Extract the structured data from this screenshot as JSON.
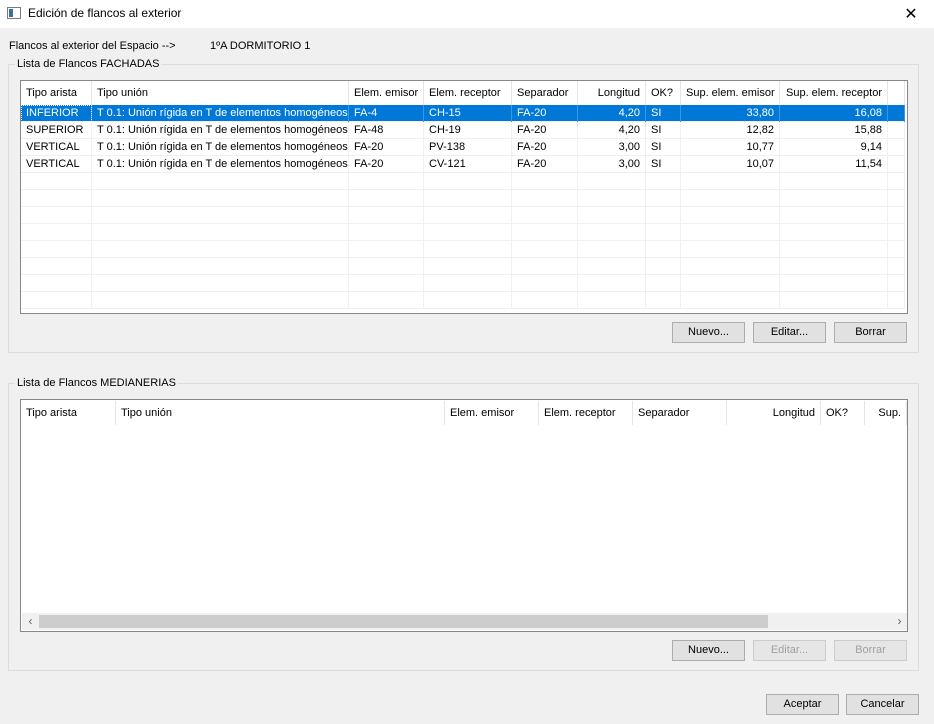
{
  "window": {
    "title": "Edición de flancos al exterior",
    "close_symbol": "✕"
  },
  "space": {
    "label": "Flancos al exterior del Espacio -->",
    "value": "1ºA DORMITORIO 1"
  },
  "fachadas": {
    "group_title": "Lista de Flancos FACHADAS",
    "columns": [
      "Tipo arista",
      "Tipo unión",
      "Elem. emisor",
      "Elem. receptor",
      "Separador",
      "Longitud",
      "OK?",
      "Sup. elem. emisor",
      "Sup. elem. receptor"
    ],
    "rows": [
      [
        "INFERIOR",
        "T 0.1: Unión rígida en T de elementos homogéneos",
        "FA-4",
        "CH-15",
        "FA-20",
        "4,20",
        "SI",
        "33,80",
        "16,08"
      ],
      [
        "SUPERIOR",
        "T 0.1: Unión rígida en T de elementos homogéneos",
        "FA-48",
        "CH-19",
        "FA-20",
        "4,20",
        "SI",
        "12,82",
        "15,88"
      ],
      [
        "VERTICAL",
        "T 0.1: Unión rígida en T de elementos homogéneos",
        "FA-20",
        "PV-138",
        "FA-20",
        "3,00",
        "SI",
        "10,77",
        "9,14"
      ],
      [
        "VERTICAL",
        "T 0.1: Unión rígida en T de elementos homogéneos",
        "FA-20",
        "CV-121",
        "FA-20",
        "3,00",
        "SI",
        "10,07",
        "11,54"
      ]
    ],
    "buttons": {
      "new": "Nuevo...",
      "edit": "Editar...",
      "delete": "Borrar"
    }
  },
  "medianerias": {
    "group_title": "Lista de Flancos MEDIANERIAS",
    "columns": [
      "Tipo arista",
      "Tipo unión",
      "Elem. emisor",
      "Elem. receptor",
      "Separador",
      "Longitud",
      "OK?",
      "Sup."
    ],
    "buttons": {
      "new": "Nuevo...",
      "edit": "Editar...",
      "delete": "Borrar"
    }
  },
  "footer": {
    "accept": "Aceptar",
    "cancel": "Cancelar"
  }
}
